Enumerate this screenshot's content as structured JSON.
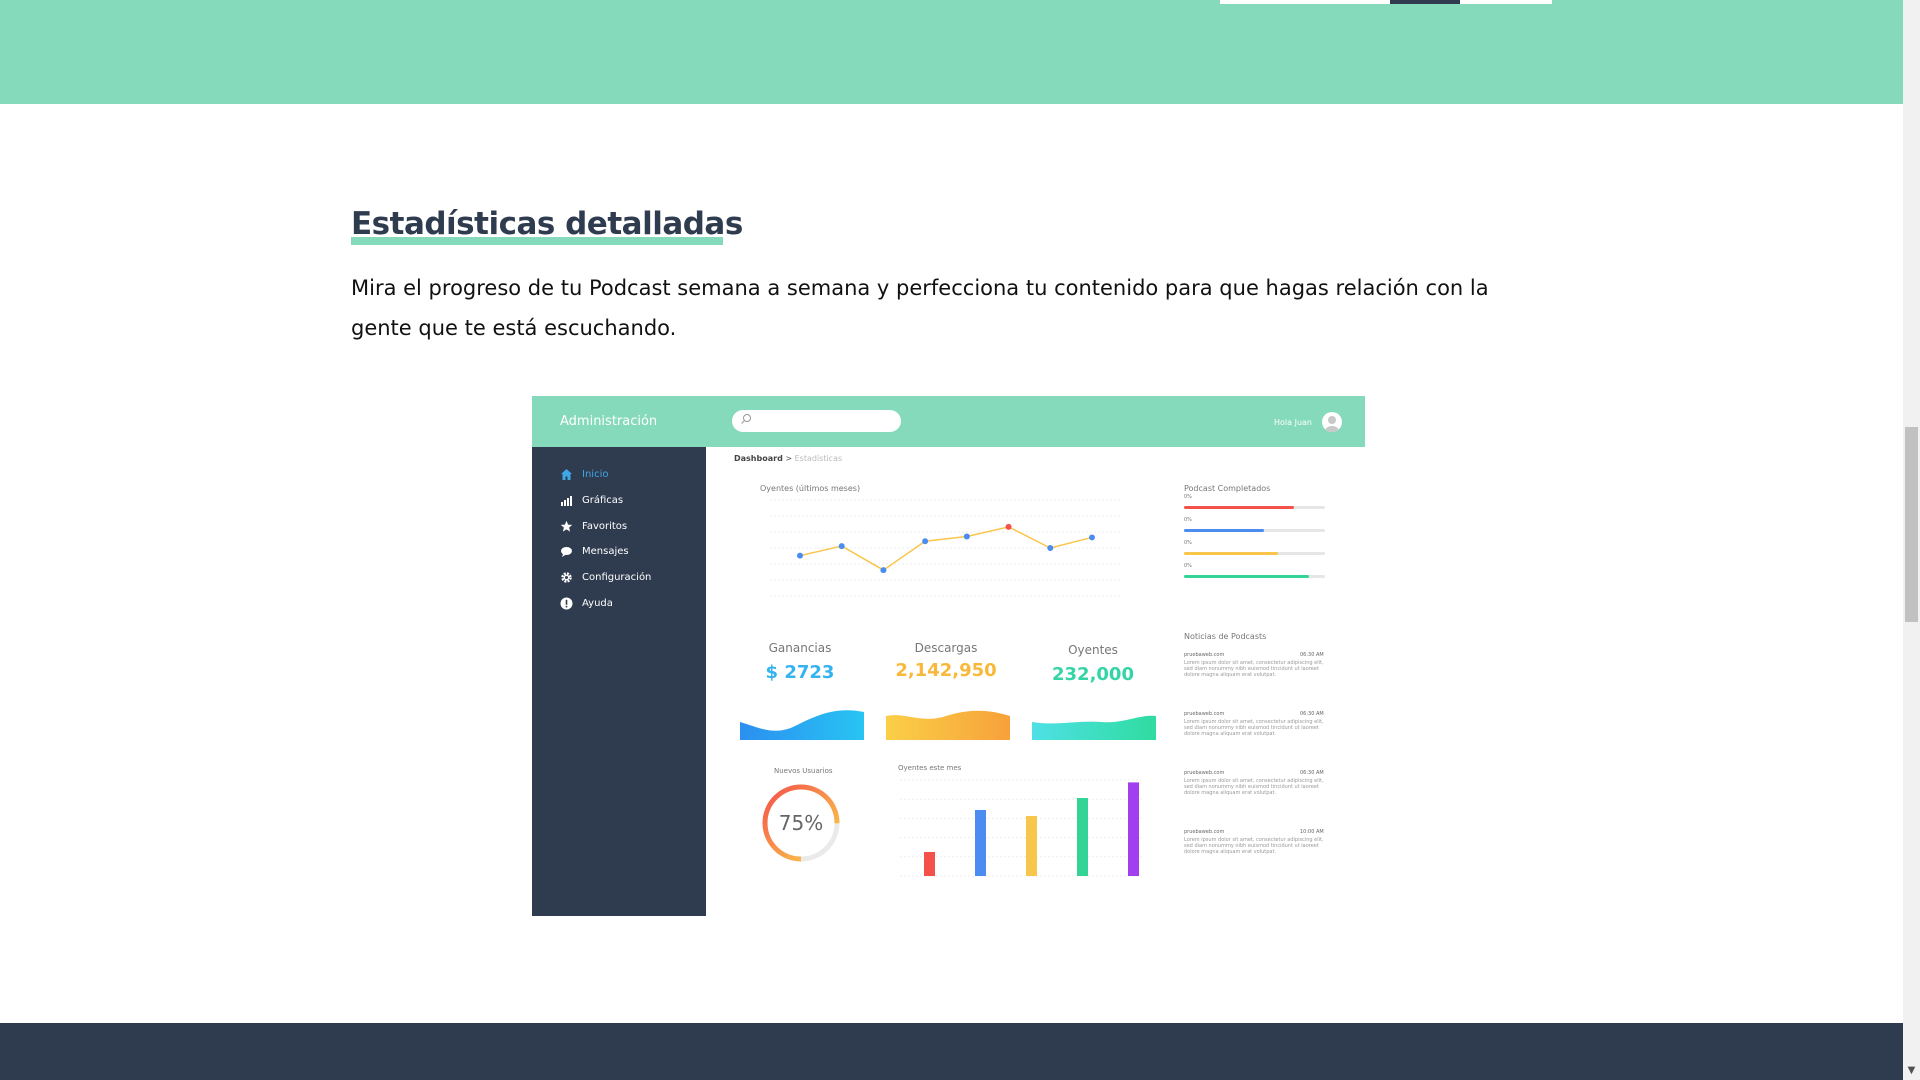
{
  "section": {
    "title": "Estadísticas detalladas",
    "description": "Mira el progreso de tu Podcast semana a semana y perfecciona tu contenido para que hagas relación con la gente que te está escuchando."
  },
  "dashboard": {
    "brand": "Administración",
    "search_placeholder": "",
    "greeting": "Hola Juan",
    "breadcrumb": {
      "root": "Dashboard",
      "separator": " > ",
      "current": "Estadísticas"
    },
    "nav": [
      {
        "label": "Inicio",
        "icon": "home-icon",
        "active": true
      },
      {
        "label": "Gráficas",
        "icon": "bar-chart-icon",
        "active": false
      },
      {
        "label": "Favoritos",
        "icon": "star-icon",
        "active": false
      },
      {
        "label": "Mensajes",
        "icon": "chat-bubble-icon",
        "active": false
      },
      {
        "label": "Configuración",
        "icon": "gear-icon",
        "active": false
      },
      {
        "label": "Ayuda",
        "icon": "info-icon",
        "active": false
      }
    ],
    "line_chart_title": "Oyentes (últimos meses)",
    "podcasts_title": "Podcast Completados",
    "podcast_progress": [
      {
        "label": "0%",
        "value": 0.78,
        "color": "#f5514b"
      },
      {
        "label": "0%",
        "value": 0.57,
        "color": "#4a8cf0"
      },
      {
        "label": "0%",
        "value": 0.67,
        "color": "#f8c64a"
      },
      {
        "label": "0%",
        "value": 0.89,
        "color": "#33d495"
      }
    ],
    "stats": [
      {
        "label": "Ganancias",
        "value": "$ 2723",
        "color": "#35b2f0"
      },
      {
        "label": "Descargas",
        "value": "2,142,950",
        "color": "#f8b93a"
      },
      {
        "label": "Oyentes",
        "value": "232,000",
        "color": "#33d4a6"
      }
    ],
    "donut": {
      "title": "Nuevos Usuarios",
      "label": "75%",
      "value": 0.75
    },
    "bar_chart_title": "Oyentes este mes",
    "news_title": "Noticias de Podcasts",
    "news": [
      {
        "source": "pruebaweb.com",
        "time": "06:30 AM",
        "body": "Lorem ipsum dolor sit amet, consectetur adipiscing elit, sed diam nonummy nibh euismod tincidunt ut laoreet dolore magna aliquam erat volutpat."
      },
      {
        "source": "pruebaweb.com",
        "time": "06:30 AM",
        "body": "Lorem ipsum dolor sit amet, consectetur adipiscing elit, sed diam nonummy nibh euismod tincidunt ut laoreet dolore magna aliquam erat volutpat."
      },
      {
        "source": "pruebaweb.com",
        "time": "06:30 AM",
        "body": "Lorem ipsum dolor sit amet, consectetur adipiscing elit, sed diam nonummy nibh euismod tincidunt ut laoreet dolore magna aliquam erat volutpat."
      },
      {
        "source": "pruebaweb.com",
        "time": "10:00 AM",
        "body": "Lorem ipsum dolor sit amet, consectetur adipiscing elit, sed diam nonummy nibh euismod tincidunt ut laoreet dolore magna aliquam erat volutpat."
      }
    ]
  },
  "chart_data": [
    {
      "type": "line",
      "title": "Oyentes (últimos meses)",
      "x": [
        1,
        2,
        3,
        4,
        5,
        6,
        7,
        8
      ],
      "values": [
        42,
        52,
        27,
        57,
        62,
        72,
        50,
        61
      ],
      "ylim": [
        0,
        100
      ],
      "color": "#f8c64a",
      "point_color": "#4a8cf0",
      "highlight_index": 5,
      "highlight_color": "#f5514b",
      "grid": true
    },
    {
      "type": "bar",
      "title": "Oyentes este mes",
      "categories": [
        "1",
        "2",
        "3",
        "4",
        "5"
      ],
      "values": [
        20,
        55,
        50,
        65,
        78
      ],
      "colors": [
        "#f5514b",
        "#4a8cf0",
        "#f8c64a",
        "#33d495",
        "#a13ef0"
      ],
      "ylim": [
        0,
        80
      ],
      "grid": true
    }
  ]
}
